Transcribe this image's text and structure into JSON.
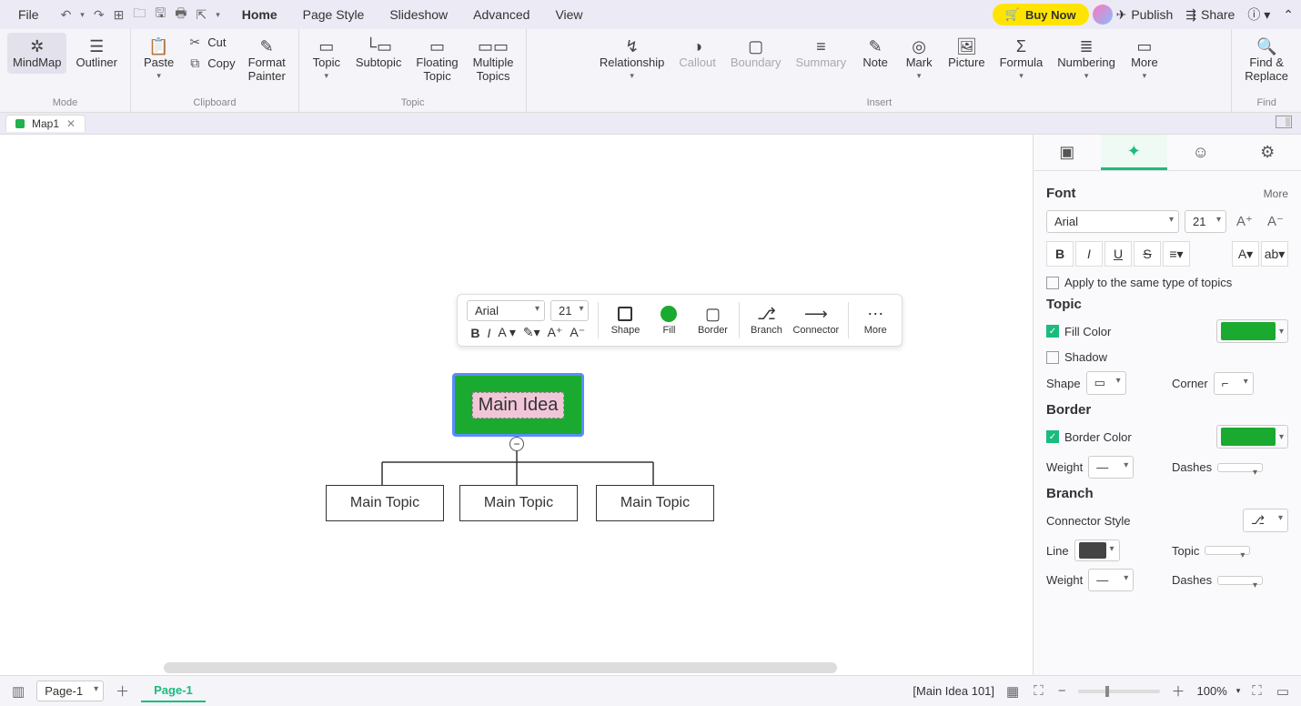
{
  "menubar": {
    "file": "File",
    "items": [
      "Home",
      "Page Style",
      "Slideshow",
      "Advanced",
      "View"
    ],
    "buy_now": "Buy Now",
    "publish": "Publish",
    "share": "Share"
  },
  "ribbon": {
    "mode": {
      "mindmap": "MindMap",
      "outliner": "Outliner",
      "label": "Mode"
    },
    "clipboard": {
      "paste": "Paste",
      "cut": "Cut",
      "copy": "Copy",
      "format_painter": "Format\nPainter",
      "label": "Clipboard"
    },
    "topic": {
      "topic": "Topic",
      "subtopic": "Subtopic",
      "floating": "Floating\nTopic",
      "multiple": "Multiple\nTopics",
      "label": "Topic"
    },
    "insert": {
      "relationship": "Relationship",
      "callout": "Callout",
      "boundary": "Boundary",
      "summary": "Summary",
      "note": "Note",
      "mark": "Mark",
      "picture": "Picture",
      "formula": "Formula",
      "numbering": "Numbering",
      "more": "More",
      "label": "Insert"
    },
    "find": {
      "find_replace": "Find &\nReplace",
      "label": "Find"
    }
  },
  "doctab": {
    "name": "Map1"
  },
  "float_tb": {
    "font": "Arial",
    "size": "21",
    "shape": "Shape",
    "fill": "Fill",
    "border": "Border",
    "branch": "Branch",
    "connector": "Connector",
    "more": "More"
  },
  "mindmap": {
    "main": "Main Idea",
    "topics": [
      "Main Topic",
      "Main Topic",
      "Main Topic"
    ]
  },
  "panel": {
    "font": {
      "title": "Font",
      "more": "More",
      "family": "Arial",
      "size": "21",
      "apply_same": "Apply to the same type of topics"
    },
    "topic": {
      "title": "Topic",
      "fill_color": "Fill Color",
      "shadow": "Shadow",
      "shape": "Shape",
      "corner": "Corner"
    },
    "border": {
      "title": "Border",
      "border_color": "Border Color",
      "weight": "Weight",
      "dashes": "Dashes"
    },
    "branch": {
      "title": "Branch",
      "connector_style": "Connector Style",
      "line": "Line",
      "topic": "Topic",
      "weight": "Weight",
      "dashes": "Dashes"
    }
  },
  "statusbar": {
    "page_sel": "Page-1",
    "page_tab": "Page-1",
    "selection": "[Main Idea 101]",
    "zoom": "100%"
  }
}
